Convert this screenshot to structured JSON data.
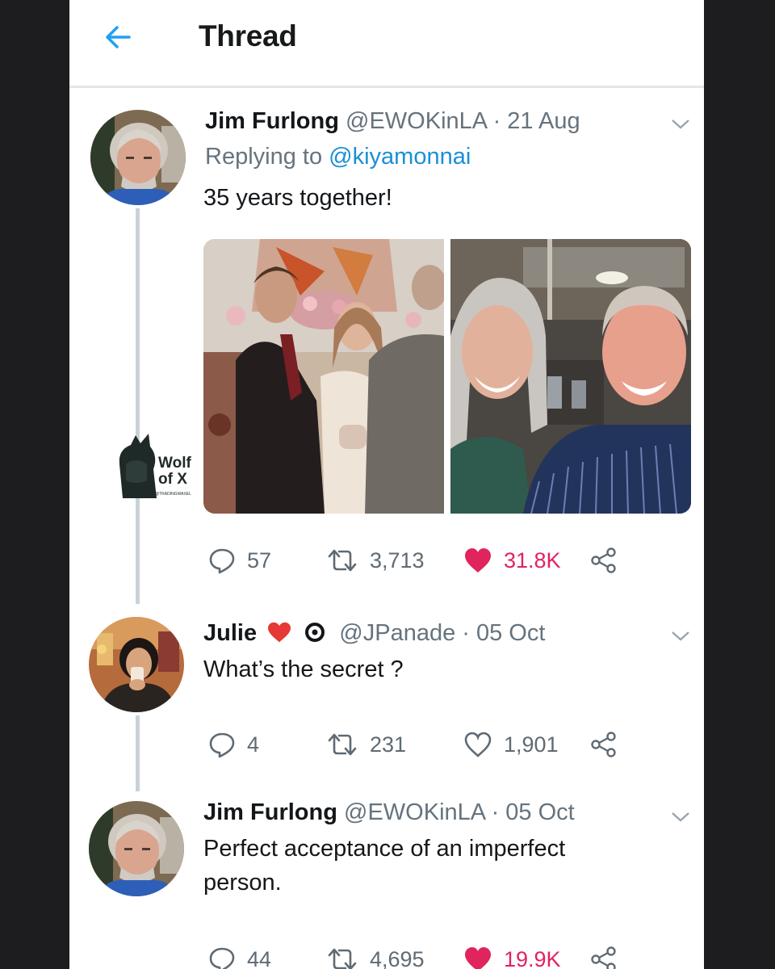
{
  "header": {
    "title": "Thread"
  },
  "tweets": [
    {
      "name": "Jim Furlong",
      "handle": "@EWOKinLA",
      "date": "· 21 Aug",
      "replying_prefix": "Replying to",
      "replying_handle": "@kiyamonnai",
      "text": "35 years together!",
      "replies": "57",
      "retweets": "3,713",
      "likes": "31.8K",
      "liked": true
    },
    {
      "name": "Julie",
      "handle": "@JPanade",
      "date": "· 05 Oct",
      "text": "What’s the secret ?",
      "replies": "4",
      "retweets": "231",
      "likes": "1,901",
      "liked": false
    },
    {
      "name": "Jim Furlong",
      "handle": "@EWOKinLA",
      "date": "· 05 Oct",
      "text": "Perfect acceptance of an imperfect person.",
      "replies": "44",
      "retweets": "4,695",
      "likes": "19.9K",
      "liked": true
    }
  ],
  "watermark": {
    "line1": "Wolf",
    "line2": "of X",
    "tag": "@TRADINGWAXEL"
  },
  "colors": {
    "accent": "#1b8fd6",
    "like": "#e0245e",
    "muted": "#66737d",
    "background_outer": "#1d1d1f"
  },
  "icons": [
    "back-arrow-icon",
    "chevron-down-icon",
    "reply-icon",
    "retweet-icon",
    "heart-icon",
    "share-icon",
    "heart-emoji-icon",
    "badge-icon"
  ]
}
